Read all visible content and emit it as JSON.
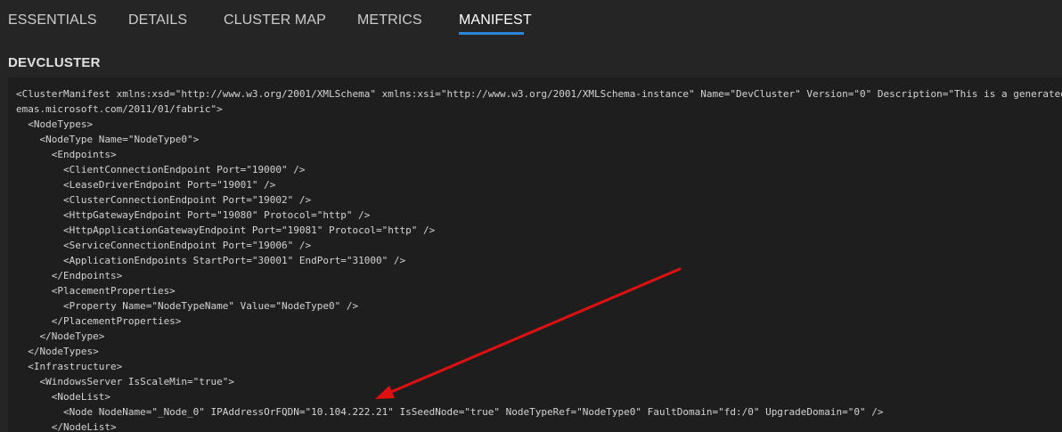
{
  "tabs": [
    {
      "label": "ESSENTIALS",
      "active": false
    },
    {
      "label": "DETAILS",
      "active": false
    },
    {
      "label": "CLUSTER MAP",
      "active": false
    },
    {
      "label": "METRICS",
      "active": false
    },
    {
      "label": "MANIFEST",
      "active": true
    }
  ],
  "section": {
    "title": "DEVCLUSTER"
  },
  "manifest": {
    "lines": [
      "<ClusterManifest xmlns:xsd=\"http://www.w3.org/2001/XMLSchema\" xmlns:xsi=\"http://www.w3.org/2001/XMLSchema-instance\" Name=\"DevCluster\" Version=\"0\" Description=\"This is a generated",
      "emas.microsoft.com/2011/01/fabric\">",
      "  <NodeTypes>",
      "    <NodeType Name=\"NodeType0\">",
      "      <Endpoints>",
      "        <ClientConnectionEndpoint Port=\"19000\" />",
      "        <LeaseDriverEndpoint Port=\"19001\" />",
      "        <ClusterConnectionEndpoint Port=\"19002\" />",
      "        <HttpGatewayEndpoint Port=\"19080\" Protocol=\"http\" />",
      "        <HttpApplicationGatewayEndpoint Port=\"19081\" Protocol=\"http\" />",
      "        <ServiceConnectionEndpoint Port=\"19006\" />",
      "        <ApplicationEndpoints StartPort=\"30001\" EndPort=\"31000\" />",
      "      </Endpoints>",
      "      <PlacementProperties>",
      "        <Property Name=\"NodeTypeName\" Value=\"NodeType0\" />",
      "      </PlacementProperties>",
      "    </NodeType>",
      "  </NodeTypes>",
      "  <Infrastructure>",
      "    <WindowsServer IsScaleMin=\"true\">",
      "      <NodeList>",
      "        <Node NodeName=\"_Node_0\" IPAddressOrFQDN=\"10.104.222.21\" IsSeedNode=\"true\" NodeTypeRef=\"NodeType0\" FaultDomain=\"fd:/0\" UpgradeDomain=\"0\" />",
      "      </NodeList>"
    ]
  },
  "colors": {
    "accent": "#2a86d6",
    "annotation_arrow": "#e01010",
    "background": "#252526",
    "code_background": "#1e1e1e"
  }
}
